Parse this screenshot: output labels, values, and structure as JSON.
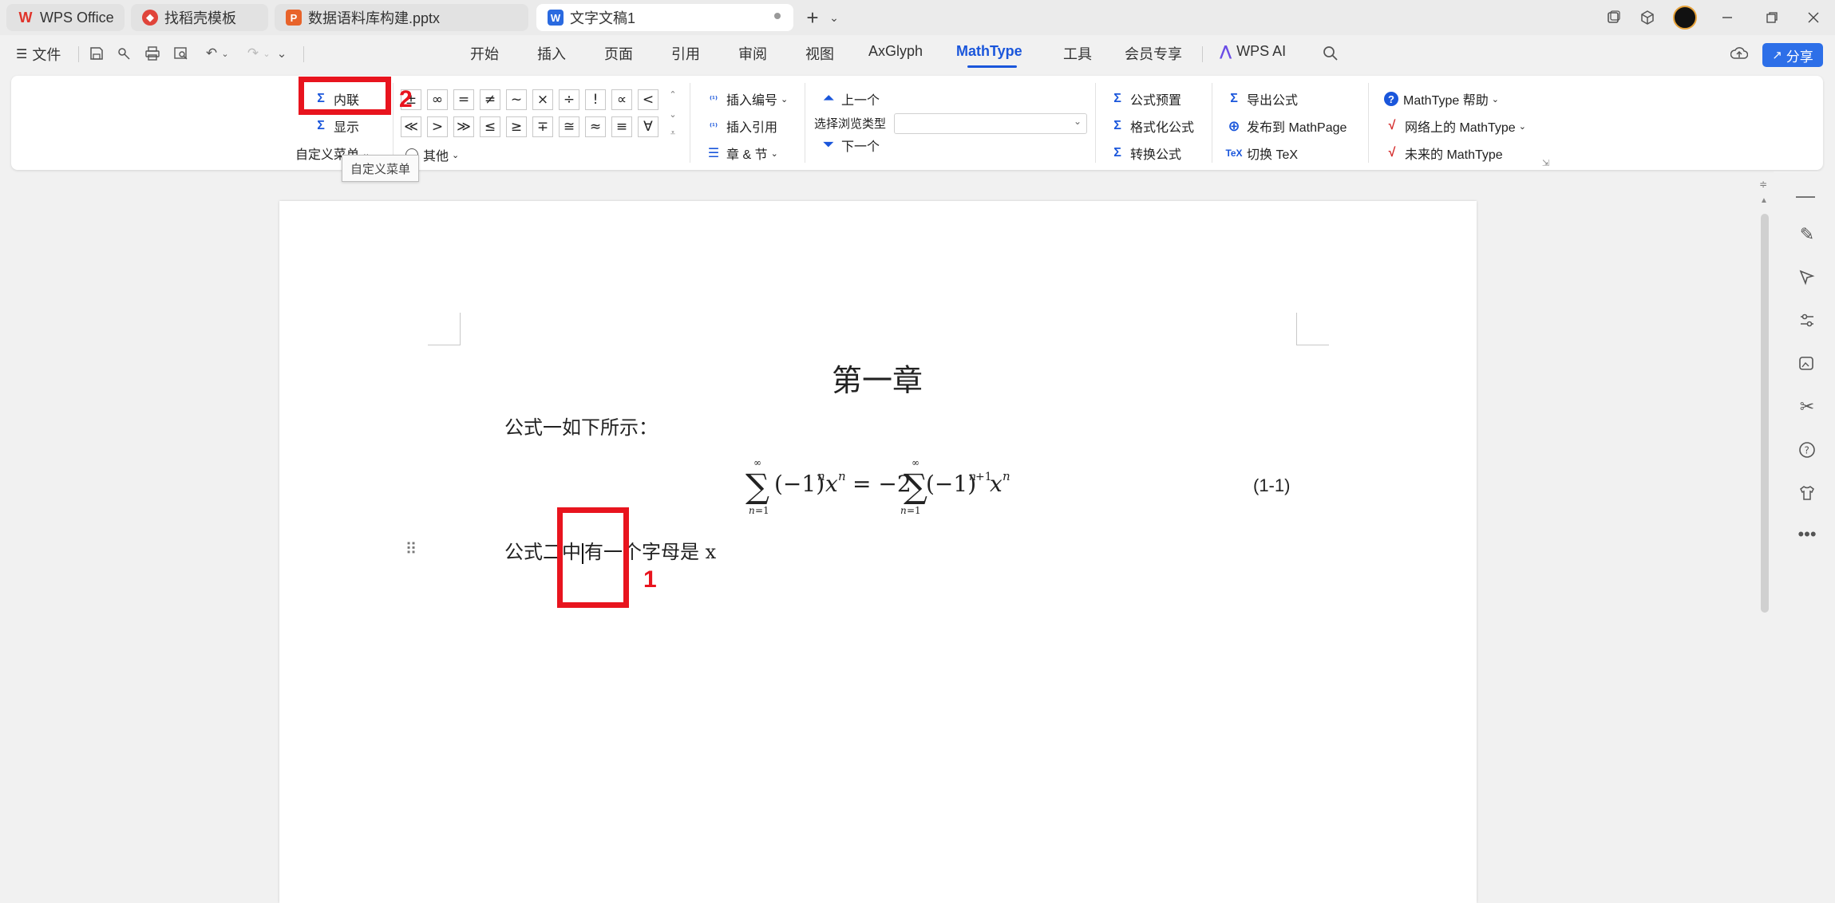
{
  "tabs": [
    {
      "label": "WPS Office",
      "icon": "wps-logo-icon"
    },
    {
      "label": "找稻壳模板",
      "icon": "docer-icon"
    },
    {
      "label": "数据语料库构建.pptx",
      "icon": "ppt-icon"
    },
    {
      "label": "文字文稿1",
      "icon": "word-icon"
    }
  ],
  "menu": {
    "file_label": "文件",
    "items": [
      "开始",
      "插入",
      "页面",
      "引用",
      "审阅",
      "视图",
      "AxGlyph",
      "MathType",
      "工具",
      "会员专享",
      "WPS AI"
    ],
    "active": "MathType",
    "share_label": "分享"
  },
  "ribbon": {
    "inline_label": "内联",
    "display_label": "显示",
    "custom_menu_label": "自定义菜单",
    "symbols_row1": [
      "±",
      "∞",
      "=",
      "≠",
      "~",
      "×",
      "÷",
      "!",
      "∝",
      "<"
    ],
    "symbols_row2": [
      "≪",
      ">",
      "≫",
      "≤",
      "≥",
      "∓",
      "≅",
      "≈",
      "≡",
      "∀"
    ],
    "other_label": "其他",
    "insert_number_label": "插入编号",
    "insert_reference_label": "插入引用",
    "chapter_section_label": "章 & 节",
    "prev_label": "上一个",
    "browse_type_label": "选择浏览类型",
    "next_label": "下一个",
    "formula_preset_label": "公式预置",
    "format_formula_label": "格式化公式",
    "convert_formula_label": "转换公式",
    "export_formula_label": "导出公式",
    "publish_label": "发布到 MathPage",
    "toggle_tex_label": "切换 TeX",
    "help_label": "MathType 帮助",
    "online_label": "网络上的 MathType",
    "future_label": "未来的 MathType",
    "tooltip": "自定义菜单"
  },
  "annotations": {
    "one": "1",
    "two": "2"
  },
  "document": {
    "title": "第一章",
    "para1": "公式一如下所示：",
    "equation_number": "(1-1)",
    "para2_a": "公式二",
    "para2_b": "中",
    "para2_c": "有一",
    "para2_d": "个字母是 x"
  },
  "colors": {
    "accent": "#1a56db",
    "annotation": "#e8141e"
  }
}
